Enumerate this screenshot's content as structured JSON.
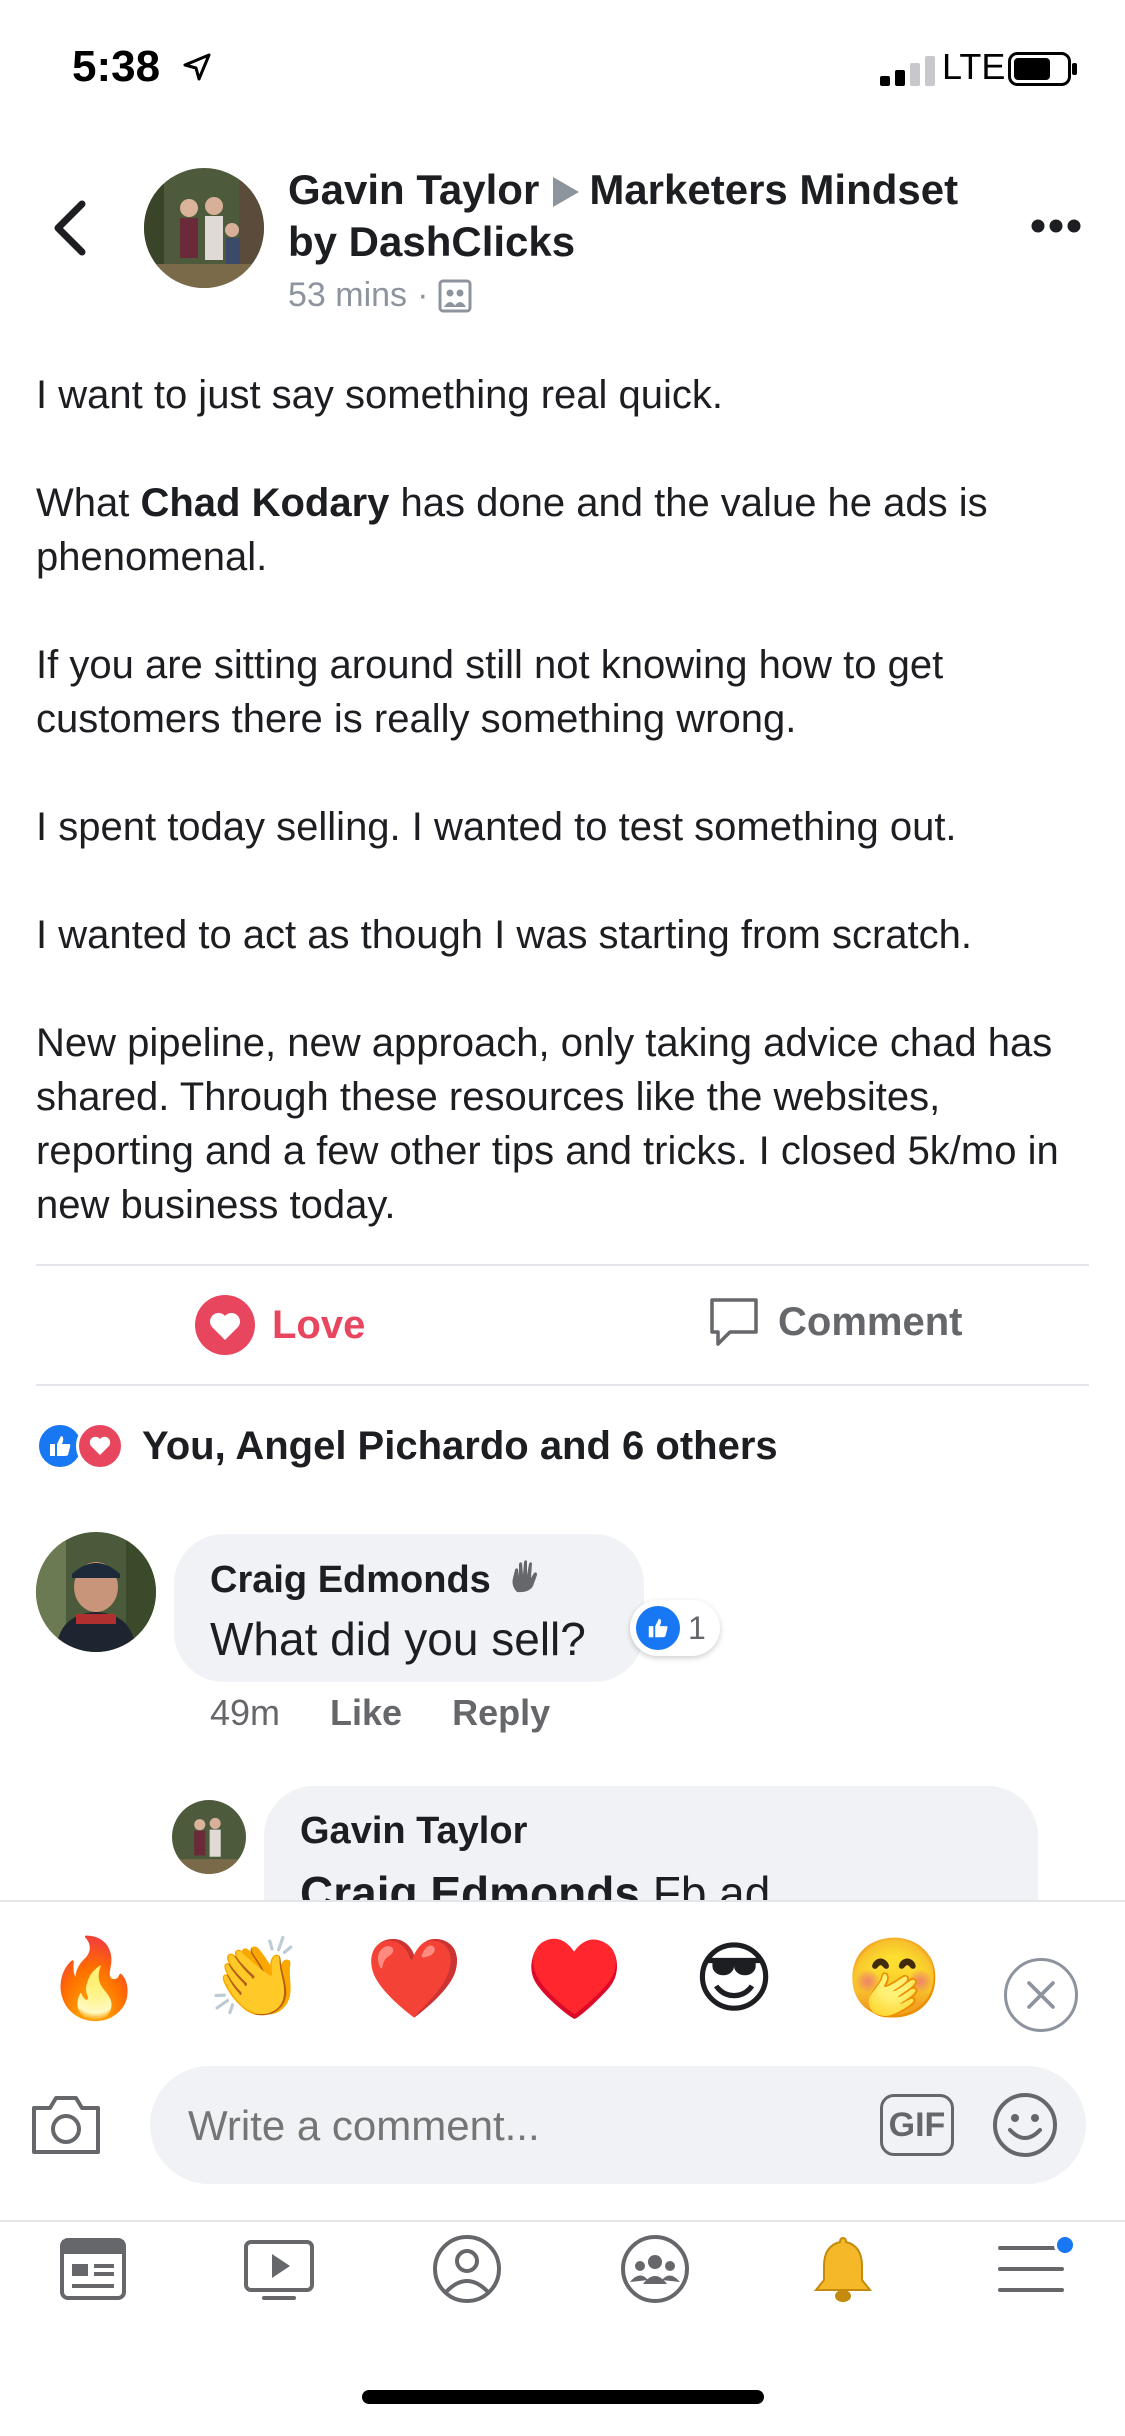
{
  "status": {
    "time": "5:38",
    "network": "LTE"
  },
  "header": {
    "author": "Gavin Taylor",
    "group": "Marketers Mindset by DashClicks",
    "time": "53 mins",
    "separator": "·"
  },
  "post": {
    "p1": "I want to just say something real quick.",
    "p2_pre": "What ",
    "p2_mention": "Chad Kodary",
    "p2_post": " has done and the value he ads is phenomenal.",
    "p3": "If you are sitting around still not knowing how to get customers there is really something wrong.",
    "p4": "I spent today selling. I wanted to test something out.",
    "p5": "I wanted to act as though I was starting from scratch.",
    "p6": "New pipeline, new approach, only taking advice chad has shared. Through these resources like the websites, reporting and a few other tips and tricks. I closed 5k/mo in new business today."
  },
  "actions": {
    "love": "Love",
    "comment": "Comment"
  },
  "reactions": {
    "summary": "You, Angel Pichardo and 6 others"
  },
  "comment1": {
    "author": "Craig Edmonds",
    "text": "What did you sell?",
    "likes": "1",
    "time": "49m",
    "like": "Like",
    "reply": "Reply"
  },
  "reply1": {
    "author": "Gavin Taylor",
    "mention": "Craig Edmonds",
    "text": " Fb ad"
  },
  "emoji_tray": [
    "🔥",
    "👏",
    "❤️",
    "♥️",
    "😎",
    "🤭"
  ],
  "composer": {
    "placeholder": "Write a comment...",
    "gif": "GIF"
  },
  "colors": {
    "love": "#e8455f",
    "like_blue": "#1877f2",
    "gray": "#65676b"
  }
}
